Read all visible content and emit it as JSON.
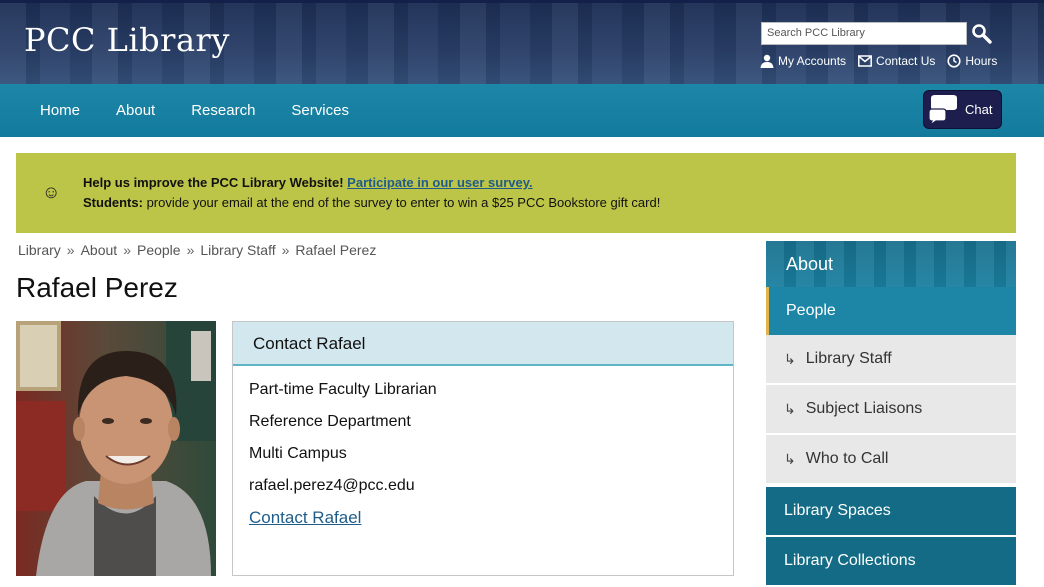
{
  "header": {
    "logo": "PCC Library",
    "search_placeholder": "Search PCC Library",
    "links": [
      {
        "label": "My Accounts",
        "icon": "person-icon"
      },
      {
        "label": "Contact Us",
        "icon": "envelope-icon"
      },
      {
        "label": "Hours",
        "icon": "clock-icon"
      }
    ]
  },
  "nav": {
    "items": [
      "Home",
      "About",
      "Research",
      "Services"
    ],
    "chat_label": "Chat"
  },
  "banner": {
    "icon": "smiley-icon",
    "line1_bold": "Help us improve the PCC Library Website!",
    "line1_link": "Participate in our user survey.",
    "line2_bold": "Students:",
    "line2_text": " provide your email at the end of the survey to enter to win a $25 PCC Bookstore gift card!"
  },
  "breadcrumb": {
    "items": [
      "Library",
      "About",
      "People",
      "Library Staff"
    ],
    "separator": "»",
    "current": "Rafael Perez"
  },
  "page_title": "Rafael Perez",
  "contact": {
    "heading": "Contact Rafael",
    "lines": [
      "Part-time Faculty Librarian",
      "Reference Department",
      "Multi Campus",
      "rafael.perez4@pcc.edu"
    ],
    "link": "Contact Rafael"
  },
  "sidebar": {
    "heading": "About",
    "active": "People",
    "sub_items": [
      "Library Staff",
      "Subject Liaisons",
      "Who to Call"
    ],
    "sub_arrow": "↳",
    "main_items": [
      "Library Spaces",
      "Library Collections"
    ]
  },
  "colors": {
    "header_bg": "#2a3f68",
    "nav_bg": "#1a82a3",
    "banner_bg": "#bcc548",
    "link": "#1f5c8a",
    "chat_bg": "#1e1e4e",
    "sidebar_active_accent": "#e3b34b"
  }
}
